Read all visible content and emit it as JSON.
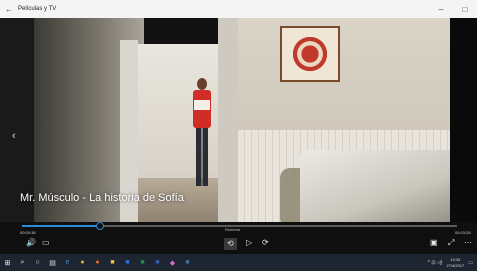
{
  "window": {
    "title": "Películas y TV",
    "back_glyph": "←",
    "minimize_glyph": "–",
    "maximize_glyph": "□"
  },
  "video": {
    "title": "Mr. Músculo - La historia de Sofía",
    "prev_glyph": "‹"
  },
  "player": {
    "progress": 0.18,
    "time_elapsed": "00:00:36",
    "time_total": "00:03:26",
    "tooltip": "Reiniciar",
    "volume_glyph": "🔊",
    "cast_glyph": "▭",
    "repeat_glyph": "⟲",
    "play_glyph": "▷",
    "forward_glyph": "⟳",
    "miniview_glyph": "▣",
    "fullscreen_glyph": "⤢",
    "more_glyph": "⋯"
  },
  "taskbar": {
    "items": [
      {
        "icon": "windows-start-icon",
        "glyph": "⊞",
        "color": "#ffffff"
      },
      {
        "icon": "search-icon",
        "glyph": "⌕",
        "color": "#e6e6e6"
      },
      {
        "icon": "cortana-icon",
        "glyph": "○",
        "color": "#e6e6e6"
      },
      {
        "icon": "task-view-icon",
        "glyph": "▤",
        "color": "#e6e6e6"
      },
      {
        "icon": "edge-icon",
        "glyph": "e",
        "color": "#2f8ad6"
      },
      {
        "icon": "chrome-icon",
        "glyph": "●",
        "color": "#e0b52b"
      },
      {
        "icon": "firefox-icon",
        "glyph": "●",
        "color": "#e6662b"
      },
      {
        "icon": "file-explorer-icon",
        "glyph": "■",
        "color": "#e9c148"
      },
      {
        "icon": "store-icon",
        "glyph": "■",
        "color": "#2f6fd6"
      },
      {
        "icon": "excel-icon",
        "glyph": "■",
        "color": "#1f8a4d"
      },
      {
        "icon": "word-icon",
        "glyph": "■",
        "color": "#2b5fb8"
      },
      {
        "icon": "paint-icon",
        "glyph": "◆",
        "color": "#d36fd2"
      },
      {
        "icon": "movies-tv-icon",
        "glyph": "■",
        "color": "#3d6fa8"
      }
    ],
    "tray_glyphs": "^  ⊡  ◁)",
    "clock_time": "10:35",
    "clock_date": "27/4/2017",
    "notifications_glyph": "▭"
  }
}
